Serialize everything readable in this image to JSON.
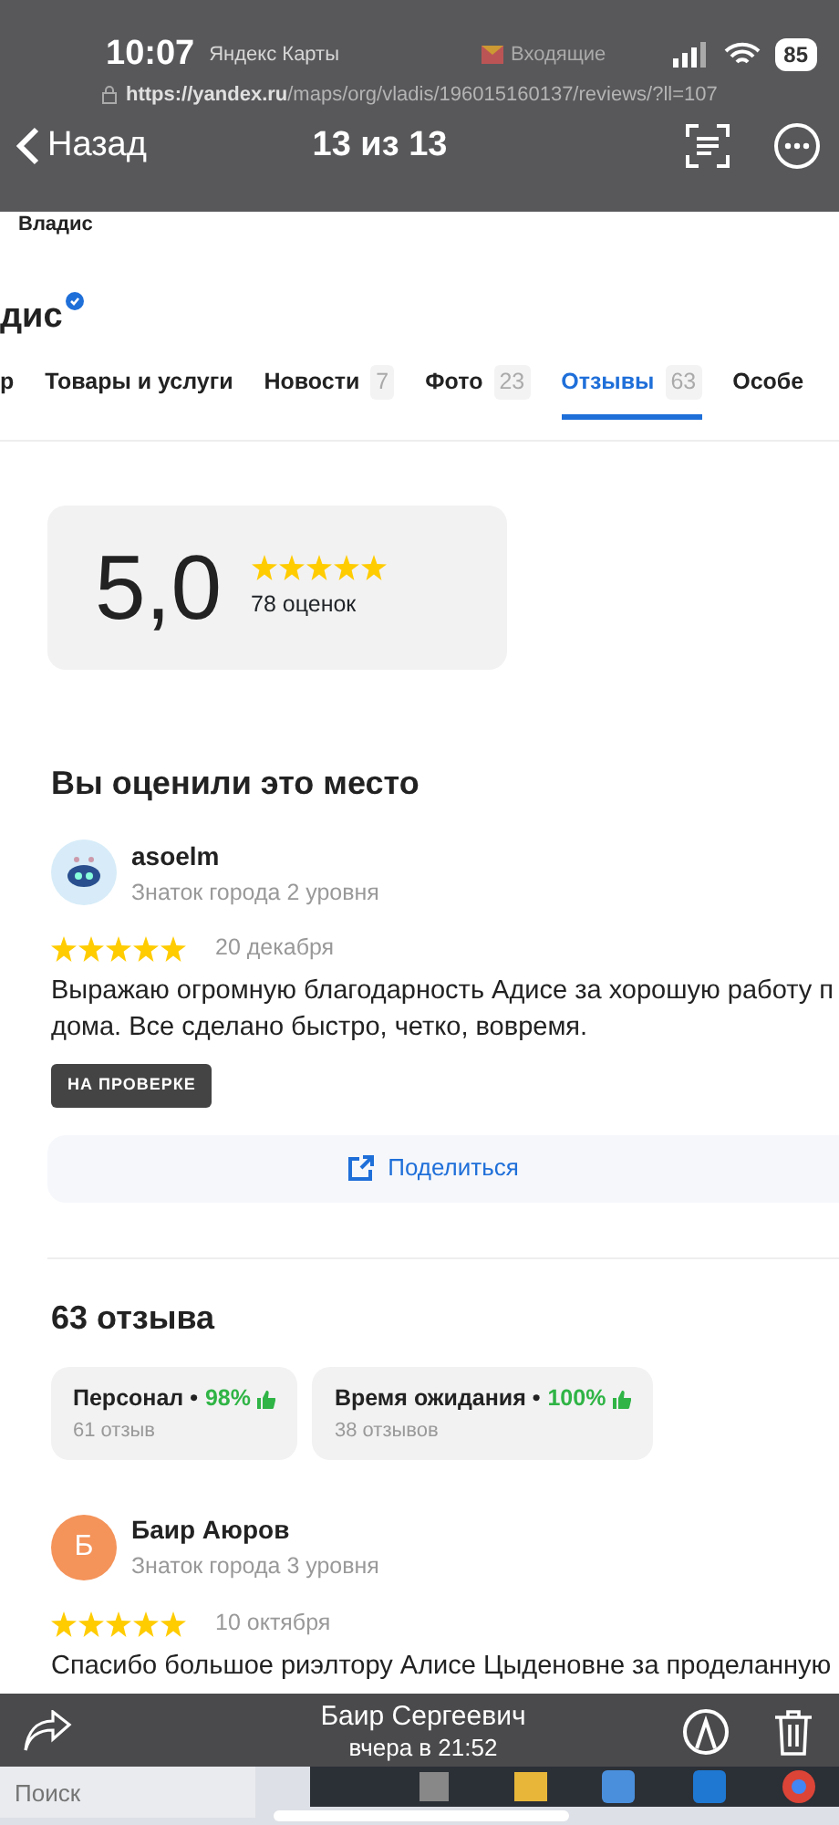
{
  "browser": {
    "tabs": [
      {
        "title": "Яндекс Карты",
        "selected": true
      },
      {
        "title": "Входящие",
        "selected": false
      }
    ],
    "url_host": "https://yandex.ru",
    "url_path": "/maps/org/vladis/196015160137/reviews/?ll=107",
    "page_title": "Владис"
  },
  "viewer": {
    "time": "10:07",
    "battery": "85",
    "back": "Назад",
    "counter": "13 из 13",
    "sender": "Баир Сергеевич",
    "sent": "вчера в 21:52"
  },
  "org": {
    "name": "дис",
    "verified": true,
    "tabs": [
      {
        "label": "р",
        "selected": false
      },
      {
        "label": "Товары и услуги",
        "selected": false
      },
      {
        "label": "Новости",
        "count": "7",
        "selected": false
      },
      {
        "label": "Фото",
        "count": "23",
        "selected": false
      },
      {
        "label": "Отзывы",
        "count": "63",
        "selected": true
      },
      {
        "label": "Особе",
        "selected": false
      }
    ]
  },
  "rating": {
    "score": "5,0",
    "stars": 5,
    "count": "78 оценок"
  },
  "my_review": {
    "heading": "Вы оценили это место",
    "author": "asoelm",
    "level": "Знаток города 2 уровня",
    "stars": 5,
    "date": "20 декабря",
    "lines": [
      "Выражаю огромную благодарность Адисе за хорошую работу п",
      "дома. Все сделано быстро, четко, вовремя."
    ],
    "status": "НА ПРОВЕРКЕ",
    "share": "Поделиться"
  },
  "reviews": {
    "heading": "63 отзыва",
    "aspects": [
      {
        "name": "Персонал",
        "separator": "•",
        "percent": "98%",
        "count": "61 отзыв"
      },
      {
        "name": "Время ожидания",
        "separator": "•",
        "percent": "100%",
        "count": "38 отзывов"
      }
    ],
    "items": [
      {
        "author": "Баир Аюров",
        "initial": "Б",
        "color": "#f4935a",
        "level": "Знаток города 3 уровня",
        "stars": 5,
        "date": "10 октября",
        "lines": [
          "Спасибо большое риэлтору Алисе Цыденовне за проделанную"
        ]
      }
    ]
  },
  "taskbar": {
    "search_placeholder": "Поиск"
  }
}
